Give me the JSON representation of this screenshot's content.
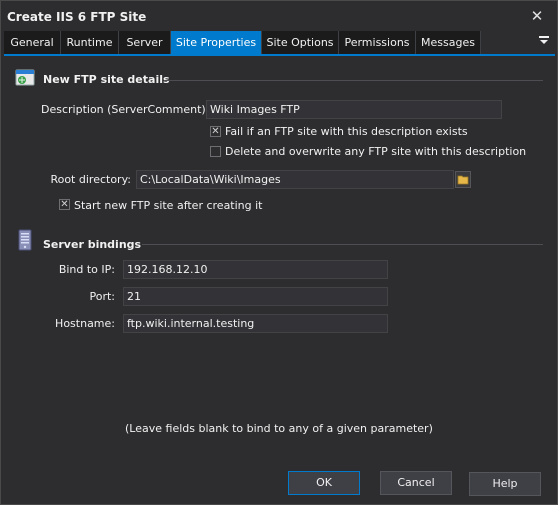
{
  "window": {
    "title": "Create IIS 6 FTP Site",
    "close_glyph": "✕"
  },
  "tabs": [
    {
      "label": "General"
    },
    {
      "label": "Runtime"
    },
    {
      "label": "Server"
    },
    {
      "label": "Site Properties",
      "active": true
    },
    {
      "label": "Site Options"
    },
    {
      "label": "Permissions"
    },
    {
      "label": "Messages"
    }
  ],
  "tab_menu_glyph": "▬",
  "ftp_section": {
    "title": "New FTP site details",
    "icon": "ftp-site-icon",
    "description_label": "Description (ServerComment):",
    "description_value": "Wiki Images FTP",
    "fail_if_exists": {
      "label": "Fail if an FTP site with this description exists",
      "checked": true
    },
    "delete_overwrite": {
      "label": "Delete and overwrite any FTP site with this description",
      "checked": false
    },
    "root_dir_label": "Root directory:",
    "root_dir_value": "C:\\LocalData\\Wiki\\Images",
    "start_after_create": {
      "label": "Start new FTP site after creating it",
      "checked": true
    }
  },
  "bindings_section": {
    "title": "Server bindings",
    "icon": "server-icon",
    "bind_ip_label": "Bind to IP:",
    "bind_ip_value": "192.168.12.10",
    "port_label": "Port:",
    "port_value": "21",
    "hostname_label": "Hostname:",
    "hostname_value": "ftp.wiki.internal.testing"
  },
  "hint": "(Leave fields blank to bind to any of a given parameter)",
  "buttons": {
    "ok": "OK",
    "cancel": "Cancel",
    "help": "Help"
  },
  "check_glyph": "✕",
  "colors": {
    "accent": "#007acc",
    "background": "#2d2d30",
    "field": "#333337"
  }
}
